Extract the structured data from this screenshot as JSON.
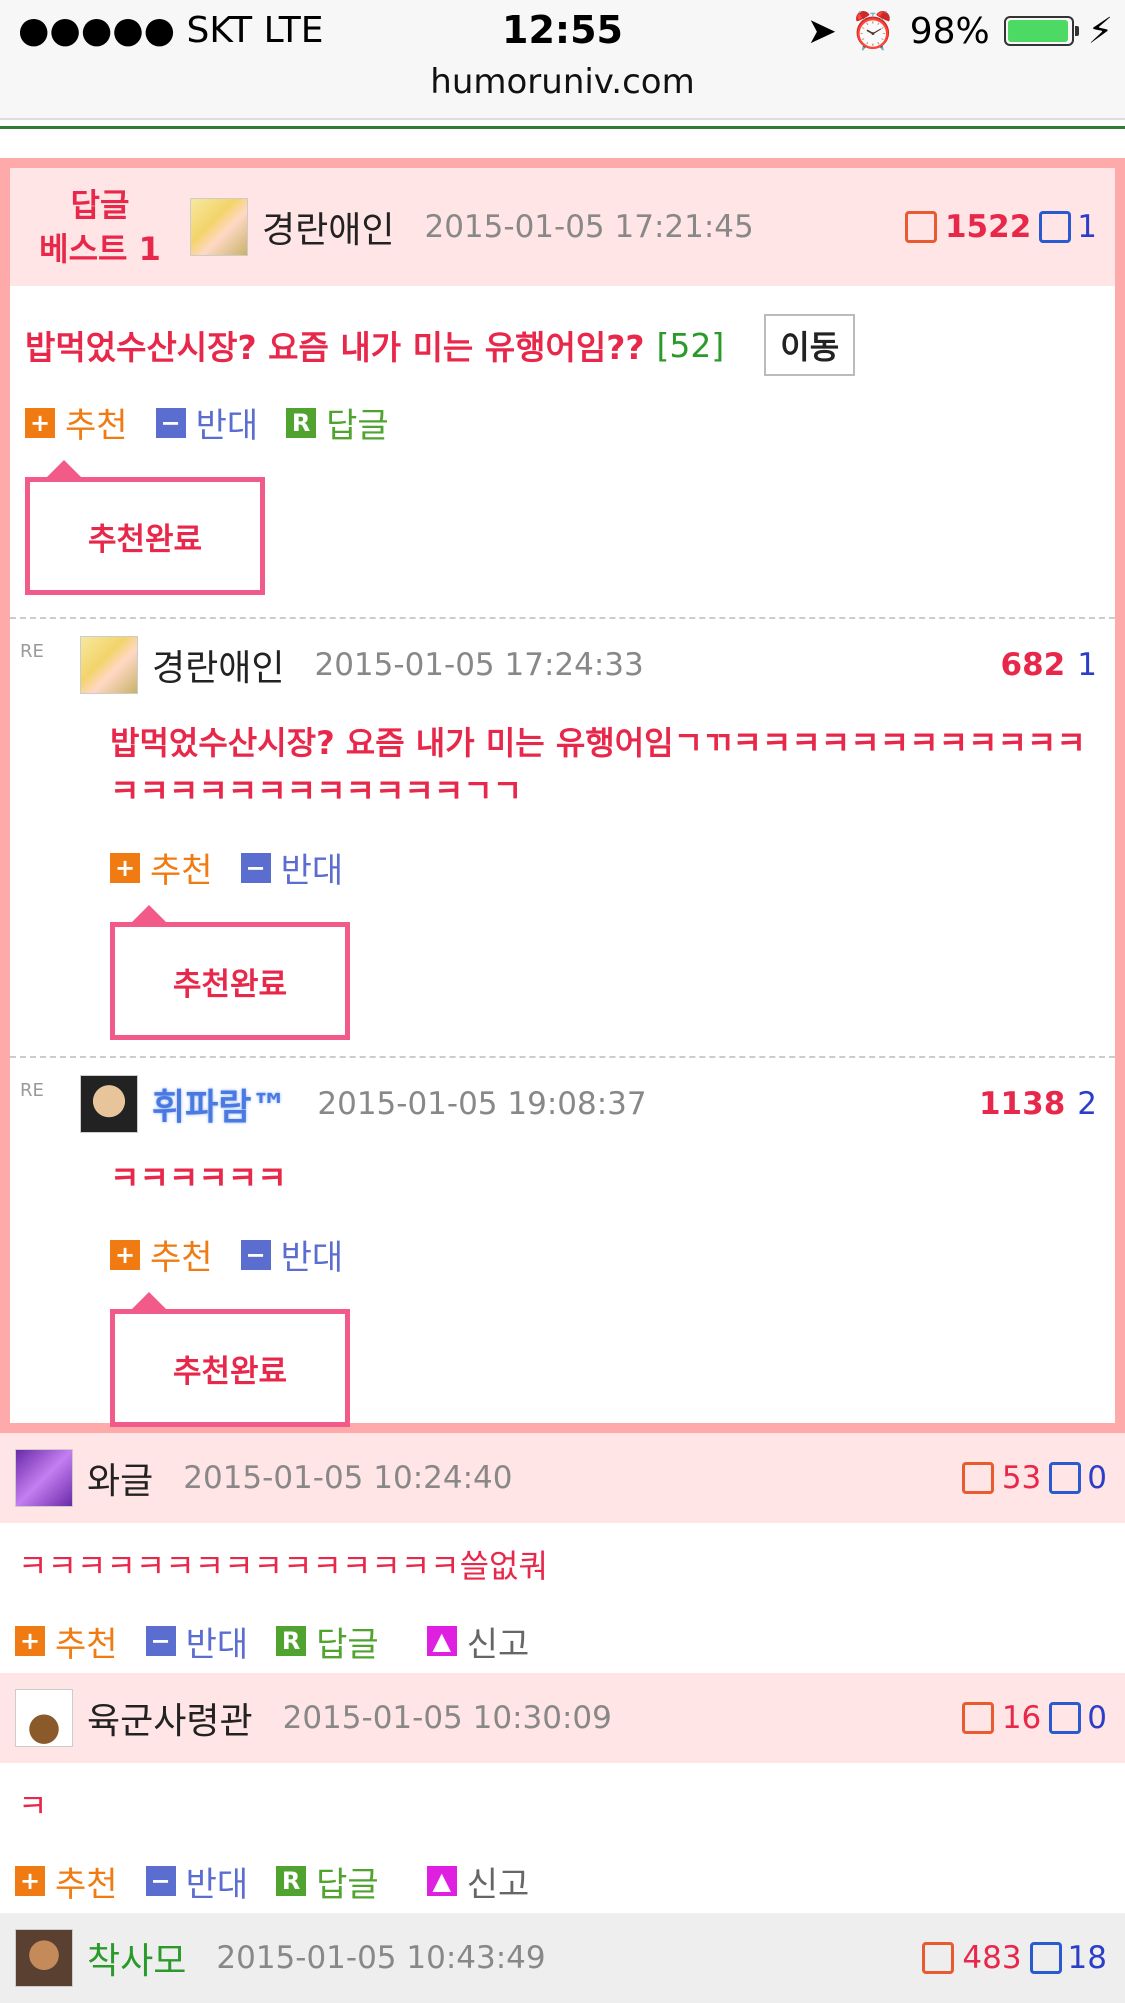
{
  "status": {
    "carrier": "●●●●● SKT   LTE",
    "time": "12:55",
    "battery": "98%",
    "battery_level": 0.98
  },
  "url": "humoruniv.com",
  "best": {
    "label_line1": "답글",
    "label_line2": "베스트 1",
    "nick": "경란애인",
    "date": "2015-01-05 17:21:45",
    "up": "1522",
    "down": "1",
    "title": "밥먹었수산시장? 요즘 내가 미는 유행어임??",
    "reply_count": "[52]",
    "move_label": "이동",
    "rec_label": "추천",
    "opp_label": "반대",
    "reply_label": "답글",
    "done_label": "추천완료"
  },
  "replies": [
    {
      "re": "RE",
      "nick": "경란애인",
      "date": "2015-01-05 17:24:33",
      "up": "682",
      "down": "1",
      "text": "밥먹었수산시장? 요즘 내가 미는 유행어임ㄱㄲㅋㅋㅋㅋㅋㅋㅋㅋㅋㅋㅋㅋㅋㅋㅋㅋㅋㅋㅋㅋㅋㅋㅋㅋㄱㄱ",
      "rec_label": "추천",
      "opp_label": "반대",
      "done_label": "추천완료"
    },
    {
      "re": "RE",
      "nick": "휘파람™",
      "date": "2015-01-05 19:08:37",
      "up": "1138",
      "down": "2",
      "text": "ㅋㅋㅋㅋㅋㅋ",
      "rec_label": "추천",
      "opp_label": "반대",
      "done_label": "추천완료"
    }
  ],
  "comments": [
    {
      "nick": "와글",
      "date": "2015-01-05 10:24:40",
      "up": "53",
      "down": "0",
      "text": "ㅋㅋㅋㅋㅋㅋㅋㅋㅋㅋㅋㅋㅋㅋㅋ쓸없쿼",
      "rec_label": "추천",
      "opp_label": "반대",
      "reply_label": "답글",
      "report_label": "신고"
    },
    {
      "nick": "육군사령관",
      "date": "2015-01-05 10:30:09",
      "up": "16",
      "down": "0",
      "text": "ㅋ",
      "rec_label": "추천",
      "opp_label": "반대",
      "reply_label": "답글",
      "report_label": "신고"
    },
    {
      "nick": "착사모",
      "date": "2015-01-05 10:43:49",
      "up": "483",
      "down": "18"
    }
  ],
  "icons": {
    "plus": "+",
    "minus": "−",
    "r": "R",
    "up": "thumb-up-icon",
    "down": "thumb-down-icon"
  },
  "colors": {
    "accent": "#e8284a",
    "border": "#ffaaaa",
    "head_bg": "#ffe5e5",
    "up": "#f07b13",
    "down": "#5b6ed0",
    "reply": "#4fa32e"
  }
}
